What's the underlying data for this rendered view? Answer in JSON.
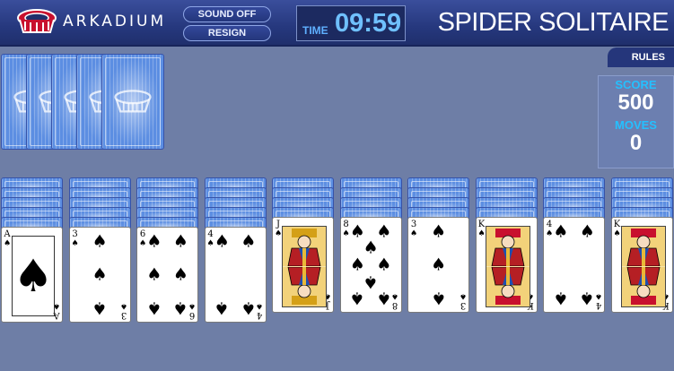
{
  "header": {
    "brand": "ARKADIUM",
    "sound_label": "SOUND OFF",
    "resign_label": "RESIGN",
    "timer_label": "TIME",
    "timer_value": "09:59",
    "title": "SPIDER SOLITAIRE"
  },
  "rules_label": "RULES",
  "score_panel": {
    "score_label": "SCORE",
    "score_value": "500",
    "moves_label": "MOVES",
    "moves_value": "0"
  },
  "stock_count": 5,
  "tableau": [
    {
      "hidden": 5,
      "rank": "A",
      "suit": "spade"
    },
    {
      "hidden": 5,
      "rank": "3",
      "suit": "spade"
    },
    {
      "hidden": 5,
      "rank": "6",
      "suit": "spade"
    },
    {
      "hidden": 5,
      "rank": "4",
      "suit": "spade"
    },
    {
      "hidden": 4,
      "rank": "J",
      "suit": "spade"
    },
    {
      "hidden": 4,
      "rank": "8",
      "suit": "spade"
    },
    {
      "hidden": 4,
      "rank": "3",
      "suit": "spade"
    },
    {
      "hidden": 4,
      "rank": "K",
      "suit": "spade"
    },
    {
      "hidden": 4,
      "rank": "4",
      "suit": "spade"
    },
    {
      "hidden": 4,
      "rank": "K",
      "suit": "spade"
    }
  ],
  "colors": {
    "background": "#6e7ea6",
    "header": "#26387e",
    "card_back": "#5c8ee2",
    "accent": "#24c0ff"
  }
}
